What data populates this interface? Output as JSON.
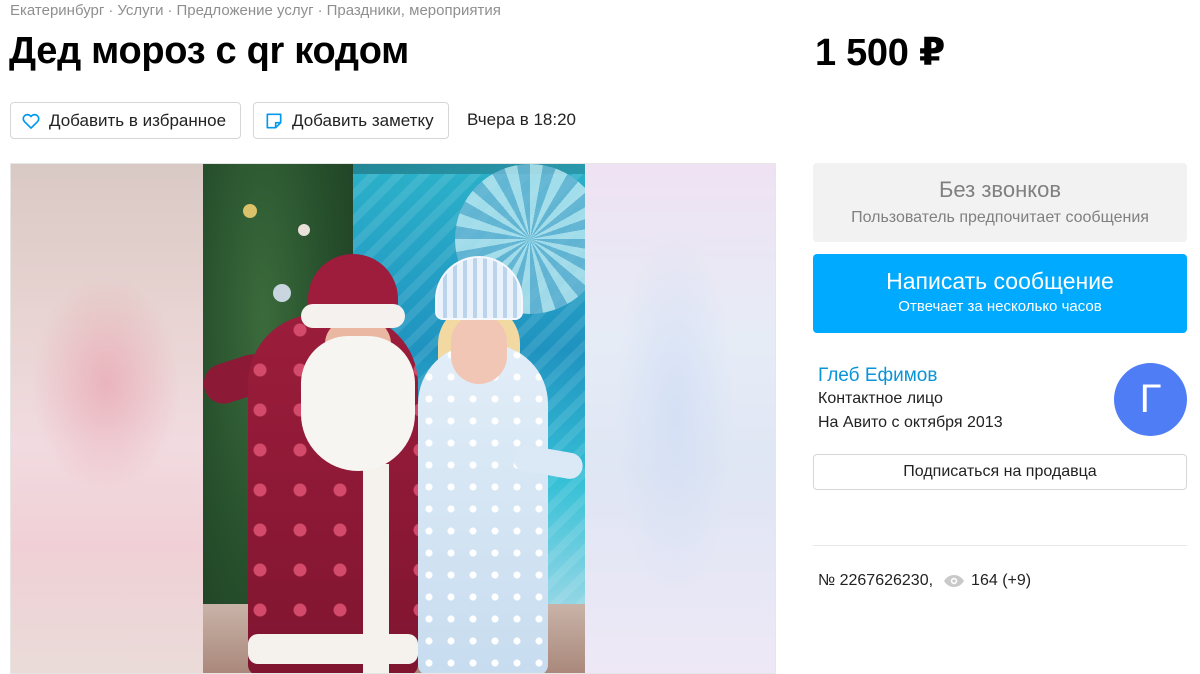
{
  "breadcrumb": {
    "items": [
      "Екатеринбург",
      "Услуги",
      "Предложение услуг",
      "Праздники, мероприятия"
    ],
    "separator": "·"
  },
  "listing": {
    "title": "Дед мороз с qr кодом",
    "price": "1 500 ₽",
    "posted": "Вчера в 18:20"
  },
  "actions": {
    "favorite_label": "Добавить в избранное",
    "note_label": "Добавить заметку"
  },
  "contact": {
    "no_calls_title": "Без звонков",
    "no_calls_subtitle": "Пользователь предпочитает сообщения",
    "message_button": "Написать сообщение",
    "message_subtitle": "Отвечает за несколько часов"
  },
  "seller": {
    "name": "Глеб Ефимов",
    "role": "Контактное лицо",
    "since": "На Авито с октября 2013",
    "avatar_letter": "Г",
    "avatar_color": "#4f7df5",
    "subscribe_label": "Подписаться на продавца"
  },
  "meta": {
    "ad_number": "№ 2267626230,",
    "views": "164 (+9)"
  },
  "colors": {
    "accent": "#00aaff",
    "link": "#0a94d8",
    "muted": "#8f8f8f"
  },
  "icons": [
    "heart-icon",
    "note-icon",
    "eye-icon"
  ]
}
